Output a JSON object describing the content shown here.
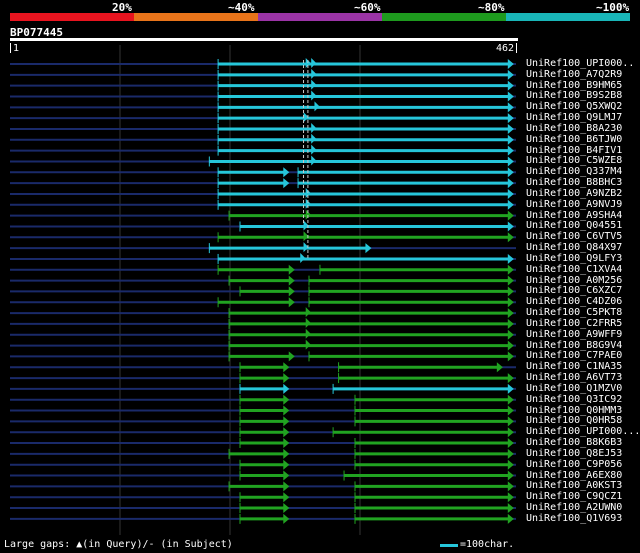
{
  "scale": {
    "labels": [
      "20%",
      "~40%",
      "~60%",
      "~80%",
      "~100%"
    ],
    "colors": [
      "#e8141f",
      "#e8741a",
      "#9b34a6",
      "#1e9a1e",
      "#19b5b8"
    ]
  },
  "query": {
    "name": "BP077445",
    "start": "1",
    "end": "462",
    "length": 462
  },
  "colors": {
    "cyan": "#26c6da",
    "green": "#21a321",
    "navy": "#1a2a6a",
    "dash": "#c8c8c8"
  },
  "hits": [
    {
      "label": "UniRef100_UPI000..",
      "color": "cyan",
      "segs": [
        [
          190,
          460
        ]
      ],
      "markers": [
        270,
        275
      ]
    },
    {
      "label": "UniRef100_A7Q2R9",
      "color": "cyan",
      "segs": [
        [
          190,
          460
        ]
      ],
      "markers": [
        275
      ]
    },
    {
      "label": "UniRef100_B9HM65",
      "color": "cyan",
      "segs": [
        [
          190,
          460
        ]
      ],
      "markers": [
        275
      ]
    },
    {
      "label": "UniRef100_B9S2B8",
      "color": "cyan",
      "segs": [
        [
          190,
          460
        ]
      ],
      "markers": [
        275
      ]
    },
    {
      "label": "UniRef100_Q5XWQ2",
      "color": "cyan",
      "segs": [
        [
          190,
          460
        ]
      ],
      "markers": [
        278
      ]
    },
    {
      "label": "UniRef100_Q9LMJ7",
      "color": "cyan",
      "segs": [
        [
          190,
          460
        ]
      ],
      "markers": [
        268
      ]
    },
    {
      "label": "UniRef100_B8A230",
      "color": "cyan",
      "segs": [
        [
          190,
          460
        ]
      ],
      "markers": [
        275
      ]
    },
    {
      "label": "UniRef100_B6TJW0",
      "color": "cyan",
      "segs": [
        [
          190,
          460
        ]
      ],
      "markers": [
        275
      ]
    },
    {
      "label": "UniRef100_B4FIV1",
      "color": "cyan",
      "segs": [
        [
          190,
          460
        ]
      ],
      "markers": [
        275
      ]
    },
    {
      "label": "UniRef100_C5WZE8",
      "color": "cyan",
      "segs": [
        [
          182,
          460
        ]
      ],
      "markers": [
        275
      ]
    },
    {
      "label": "UniRef100_Q337M4",
      "color": "cyan",
      "segs": [
        [
          190,
          255
        ],
        [
          263,
          460
        ]
      ],
      "markers": []
    },
    {
      "label": "UniRef100_B8BHC3",
      "color": "cyan",
      "segs": [
        [
          190,
          255
        ],
        [
          263,
          460
        ]
      ],
      "markers": []
    },
    {
      "label": "UniRef100_A9NZB2",
      "color": "cyan",
      "segs": [
        [
          190,
          460
        ]
      ],
      "markers": [
        270
      ]
    },
    {
      "label": "UniRef100_A9NVJ9",
      "color": "cyan",
      "segs": [
        [
          190,
          460
        ]
      ],
      "markers": [
        270
      ]
    },
    {
      "label": "UniRef100_A9SHA4",
      "color": "green",
      "segs": [
        [
          200,
          460
        ]
      ],
      "markers": [
        270
      ]
    },
    {
      "label": "UniRef100_Q04551",
      "color": "cyan",
      "segs": [
        [
          210,
          460
        ]
      ],
      "markers": [
        268
      ]
    },
    {
      "label": "UniRef100_C6VTV5",
      "color": "green",
      "segs": [
        [
          190,
          460
        ]
      ],
      "markers": [
        268
      ]
    },
    {
      "label": "UniRef100_Q84X97",
      "color": "cyan",
      "segs": [
        [
          182,
          330
        ]
      ],
      "markers": [
        268
      ]
    },
    {
      "label": "UniRef100_Q9LFY3",
      "color": "cyan",
      "segs": [
        [
          190,
          460
        ]
      ],
      "markers": [
        265
      ]
    },
    {
      "label": "UniRef100_C1XVA4",
      "color": "green",
      "segs": [
        [
          190,
          260
        ],
        [
          283,
          460
        ]
      ],
      "markers": []
    },
    {
      "label": "UniRef100_A0M256",
      "color": "green",
      "segs": [
        [
          200,
          260
        ],
        [
          273,
          460
        ]
      ],
      "markers": []
    },
    {
      "label": "UniRef100_C6XZC7",
      "color": "green",
      "segs": [
        [
          210,
          260
        ],
        [
          273,
          460
        ]
      ],
      "markers": []
    },
    {
      "label": "UniRef100_C4DZ06",
      "color": "green",
      "segs": [
        [
          190,
          260
        ],
        [
          273,
          460
        ]
      ],
      "markers": []
    },
    {
      "label": "UniRef100_C5PKT8",
      "color": "green",
      "segs": [
        [
          200,
          460
        ]
      ],
      "markers": [
        270
      ]
    },
    {
      "label": "UniRef100_C2FRR5",
      "color": "green",
      "segs": [
        [
          200,
          460
        ]
      ],
      "markers": [
        270
      ]
    },
    {
      "label": "UniRef100_A9WFF9",
      "color": "green",
      "segs": [
        [
          200,
          460
        ]
      ],
      "markers": [
        270
      ]
    },
    {
      "label": "UniRef100_B8G9V4",
      "color": "green",
      "segs": [
        [
          200,
          460
        ]
      ],
      "markers": [
        270
      ]
    },
    {
      "label": "UniRef100_C7PAE0",
      "color": "green",
      "segs": [
        [
          200,
          260
        ],
        [
          273,
          460
        ]
      ],
      "markers": []
    },
    {
      "label": "UniRef100_C1NA35",
      "color": "green",
      "segs": [
        [
          210,
          255
        ],
        [
          300,
          450
        ]
      ],
      "markers": []
    },
    {
      "label": "UniRef100_A6VT73",
      "color": "green",
      "segs": [
        [
          210,
          255
        ],
        [
          300,
          460
        ]
      ],
      "markers": []
    },
    {
      "label": "UniRef100_Q1MZV0",
      "color": "cyan",
      "segs": [
        [
          210,
          255
        ],
        [
          295,
          460
        ]
      ],
      "markers": []
    },
    {
      "label": "UniRef100_Q3IC92",
      "color": "green",
      "segs": [
        [
          210,
          255
        ],
        [
          315,
          460
        ]
      ],
      "markers": []
    },
    {
      "label": "UniRef100_Q0HMM3",
      "color": "green",
      "segs": [
        [
          210,
          255
        ],
        [
          315,
          460
        ]
      ],
      "markers": []
    },
    {
      "label": "UniRef100_Q0HR58",
      "color": "green",
      "segs": [
        [
          210,
          255
        ],
        [
          315,
          460
        ]
      ],
      "markers": []
    },
    {
      "label": "UniRef100_UPI000...",
      "color": "green",
      "segs": [
        [
          210,
          255
        ],
        [
          295,
          460
        ]
      ],
      "markers": []
    },
    {
      "label": "UniRef100_B8K6B3",
      "color": "green",
      "segs": [
        [
          210,
          255
        ],
        [
          315,
          460
        ]
      ],
      "markers": []
    },
    {
      "label": "UniRef100_Q8EJ53",
      "color": "green",
      "segs": [
        [
          200,
          255
        ],
        [
          315,
          460
        ]
      ],
      "markers": []
    },
    {
      "label": "UniRef100_C9P056",
      "color": "green",
      "segs": [
        [
          210,
          255
        ],
        [
          315,
          460
        ]
      ],
      "markers": []
    },
    {
      "label": "UniRef100_A6EX80",
      "color": "green",
      "segs": [
        [
          210,
          255
        ],
        [
          305,
          460
        ]
      ],
      "markers": []
    },
    {
      "label": "UniRef100_A0KST3",
      "color": "green",
      "segs": [
        [
          200,
          255
        ],
        [
          315,
          460
        ]
      ],
      "markers": []
    },
    {
      "label": "UniRef100_C9QCZ1",
      "color": "green",
      "segs": [
        [
          210,
          255
        ],
        [
          315,
          460
        ]
      ],
      "markers": []
    },
    {
      "label": "UniRef100_A2UWN0",
      "color": "green",
      "segs": [
        [
          210,
          255
        ],
        [
          315,
          460
        ]
      ],
      "markers": []
    },
    {
      "label": "UniRef100_Q1V693",
      "color": "green",
      "segs": [
        [
          210,
          255
        ],
        [
          315,
          460
        ]
      ],
      "markers": []
    }
  ],
  "legend": {
    "text": "Large gaps: ▲(in Query)/- (in Subject)",
    "scale_text": "=100char."
  }
}
